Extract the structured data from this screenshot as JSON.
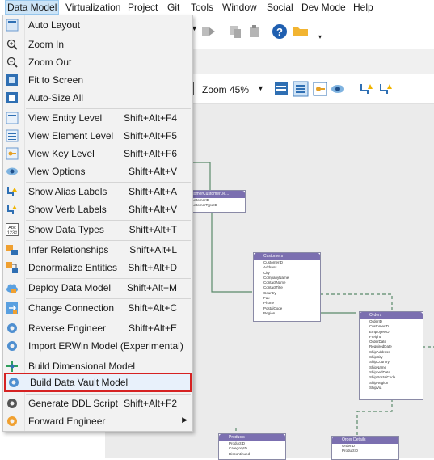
{
  "menubar": [
    "Data Model",
    "Virtualization",
    "Project",
    "Git",
    "Tools",
    "Window",
    "Social",
    "Dev Mode",
    "Help"
  ],
  "toolbar": {
    "zoom_label": "Zoom",
    "zoom_value": "45%"
  },
  "menu": {
    "items": [
      {
        "label": "Auto Layout",
        "shortcut": "",
        "icon": "auto-layout-icon"
      },
      {
        "label": "Zoom In",
        "shortcut": "",
        "icon": "zoom-in-icon"
      },
      {
        "label": "Zoom Out",
        "shortcut": "",
        "icon": "zoom-out-icon"
      },
      {
        "label": "Fit to Screen",
        "shortcut": "",
        "icon": "fit-screen-icon"
      },
      {
        "label": "Auto-Size All",
        "shortcut": "",
        "icon": "auto-size-icon"
      },
      {
        "label": "View Entity Level",
        "shortcut": "Shift+Alt+F4",
        "icon": "entity-level-icon"
      },
      {
        "label": "View Element Level",
        "shortcut": "Shift+Alt+F5",
        "icon": "element-level-icon"
      },
      {
        "label": "View Key Level",
        "shortcut": "Shift+Alt+F6",
        "icon": "key-level-icon"
      },
      {
        "label": "View Options",
        "shortcut": "Shift+Alt+V",
        "icon": "view-options-icon"
      },
      {
        "label": "Show Alias Labels",
        "shortcut": "Shift+Alt+A",
        "icon": "alias-labels-icon"
      },
      {
        "label": "Show Verb Labels",
        "shortcut": "Shift+Alt+V",
        "icon": "verb-labels-icon"
      },
      {
        "label": "Show Data Types",
        "shortcut": "Shift+Alt+T",
        "icon": "data-types-icon"
      },
      {
        "label": "Infer Relationships",
        "shortcut": "Shift+Alt+L",
        "icon": "infer-relationships-icon"
      },
      {
        "label": "Denormalize Entities",
        "shortcut": "Shift+Alt+D",
        "icon": "denormalize-icon"
      },
      {
        "label": "Deploy Data Model",
        "shortcut": "Shift+Alt+M",
        "icon": "deploy-cloud-icon"
      },
      {
        "label": "Change Connection",
        "shortcut": "Shift+Alt+C",
        "icon": "change-connection-icon"
      },
      {
        "label": "Reverse Engineer",
        "shortcut": "Shift+Alt+E",
        "icon": "gear-icon"
      },
      {
        "label": "Import ERWin Model (Experimental)",
        "shortcut": "",
        "icon": "gear-icon"
      },
      {
        "label": "Build Dimensional Model",
        "shortcut": "",
        "icon": "dimensional-model-icon"
      },
      {
        "label": "Build Data Vault Model",
        "shortcut": "",
        "icon": "gear-icon"
      },
      {
        "label": "Generate DDL Script",
        "shortcut": "Shift+Alt+F2",
        "icon": "gear-dark-icon"
      },
      {
        "label": "Forward Engineer",
        "shortcut": "",
        "icon": "gear-orange-icon"
      }
    ],
    "icon_glyphs": {
      "abc_top": "Abc",
      "abc_bottom": "123#"
    }
  },
  "entities": {
    "customer_type": {
      "title": "ustomerCustomerDe...",
      "rows": [
        "CustomerID",
        "CustomerTypeID"
      ]
    },
    "customers": {
      "title": "Customers",
      "rows": [
        "CustomerID",
        "Address",
        "City",
        "CompanyName",
        "ContactName",
        "ContactTitle",
        "Country",
        "Fax",
        "Phone",
        "PostalCode",
        "Region"
      ]
    },
    "orders": {
      "title": "Orders",
      "rows": [
        "OrderID",
        "CustomerID",
        "EmployeeID",
        "Freight",
        "OrderDate",
        "RequiredDate",
        "ShipAddress",
        "ShipCity",
        "ShipCountry",
        "ShipName",
        "ShippedDate",
        "ShipPostalCode",
        "ShipRegion",
        "ShipVia"
      ]
    },
    "products": {
      "title": "Products",
      "rows": [
        "ProductID",
        "CategoryID",
        "Discontinued"
      ]
    },
    "order_details": {
      "title": "Order Details",
      "rows": [
        "OrderID",
        "ProductID"
      ]
    }
  },
  "colors": {
    "entity_header": "#7b6fb0",
    "highlight_border": "#d62222",
    "relation_line": "#5a8a6a"
  }
}
